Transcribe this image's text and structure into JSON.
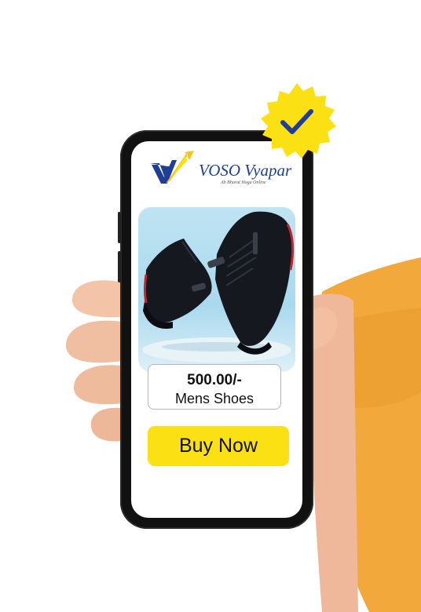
{
  "brand": {
    "name": "VOSO Vyapar",
    "tagline": "Ab Bharat Hoga Online",
    "colors": {
      "blue": "#1f3f97",
      "yellow": "#fbe013"
    }
  },
  "product": {
    "price": "500.00/-",
    "name": "Mens Shoes",
    "image_icon": "sneakers-image"
  },
  "cta": {
    "label": "Buy Now",
    "color": "#fbe013"
  },
  "badge": {
    "icon": "checkmark-icon",
    "color": "#fbe013"
  }
}
